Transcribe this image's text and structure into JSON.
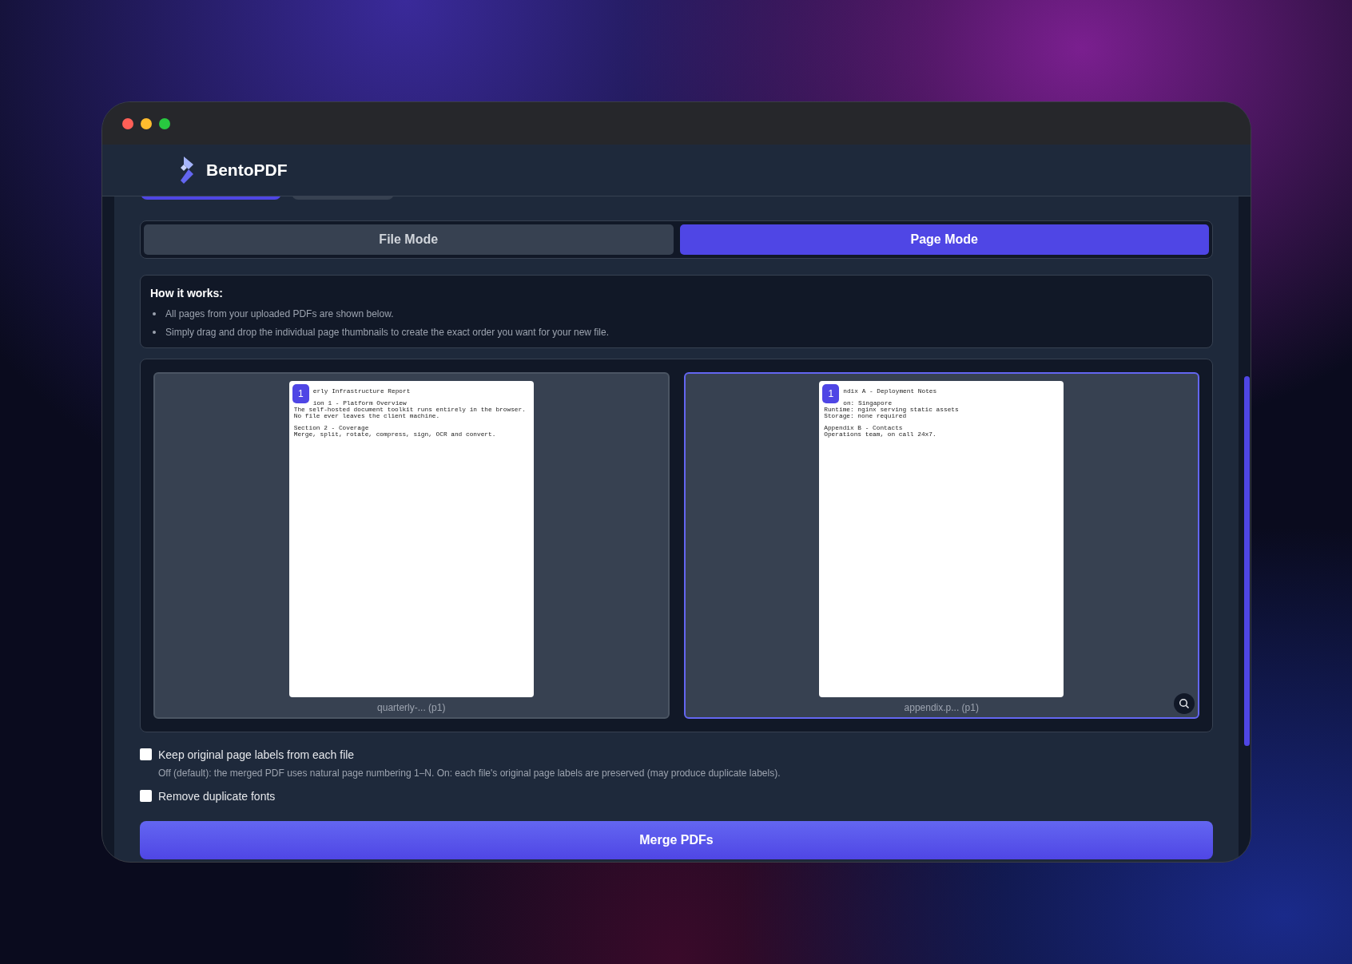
{
  "header": {
    "app_name": "BentoPDF"
  },
  "top_tabs": [
    {
      "selected": true
    },
    {
      "selected": false
    }
  ],
  "modes": [
    {
      "label": "File Mode",
      "selected": false
    },
    {
      "label": "Page Mode",
      "selected": true
    }
  ],
  "info": {
    "title": "How it works:",
    "items": [
      "All pages from your uploaded PDFs are shown below.",
      "Simply drag and drop the individual page thumbnails to create the exact order you want for your new file."
    ]
  },
  "pages": [
    {
      "badge": "1",
      "caption": "quarterly-... (p1)",
      "selected": false,
      "lines": [
        {
          "kind": "clipped",
          "text": "erly Infrastructure Report"
        },
        {
          "kind": "gap"
        },
        {
          "kind": "clipped",
          "text": "ion 1 - Platform Overview"
        },
        {
          "kind": "plain",
          "text": "The self-hosted document toolkit runs entirely in the browser."
        },
        {
          "kind": "plain",
          "text": "No file ever leaves the client machine."
        },
        {
          "kind": "gap"
        },
        {
          "kind": "plain",
          "text": "Section 2 - Coverage"
        },
        {
          "kind": "plain",
          "text": "Merge, split, rotate, compress, sign, OCR and convert."
        }
      ]
    },
    {
      "badge": "1",
      "caption": "appendix.p... (p1)",
      "selected": true,
      "lines": [
        {
          "kind": "clipped",
          "text": "ndix A - Deployment Notes"
        },
        {
          "kind": "gap"
        },
        {
          "kind": "clipped",
          "text": "on: Singapore"
        },
        {
          "kind": "plain",
          "text": "Runtime: nginx serving static assets"
        },
        {
          "kind": "plain",
          "text": "Storage: none required"
        },
        {
          "kind": "gap"
        },
        {
          "kind": "plain",
          "text": "Appendix B - Contacts"
        },
        {
          "kind": "plain",
          "text": "Operations team, on call 24x7."
        }
      ]
    }
  ],
  "options": [
    {
      "label": "Keep original page labels from each file",
      "checked": false,
      "hint": "Off (default): the merged PDF uses natural page numbering 1–N. On: each file's original page labels are preserved (may produce duplicate labels)."
    },
    {
      "label": "Remove duplicate fonts",
      "checked": false
    }
  ],
  "merge_button": "Merge PDFs"
}
